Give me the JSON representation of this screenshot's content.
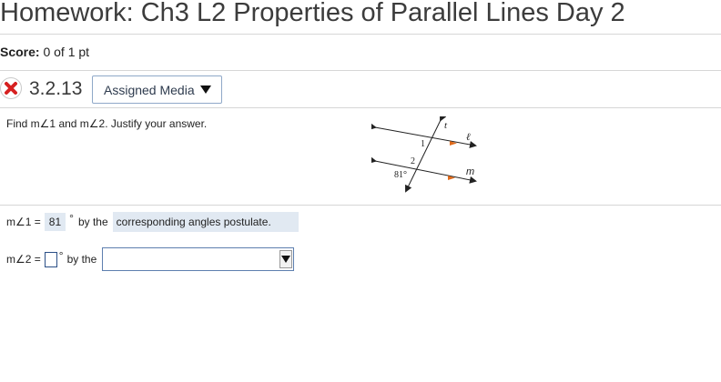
{
  "header": {
    "title": "Homework: Ch3 L2 Properties of Parallel Lines Day 2"
  },
  "score": {
    "label": "Score:",
    "value": "0 of 1 pt"
  },
  "question": {
    "number": "3.2.13",
    "media_button": "Assigned Media",
    "prompt": "Find m∠1 and m∠2. Justify your answer."
  },
  "figure": {
    "transversal_label": "t",
    "line_l_label": "ℓ",
    "line_m_label": "m",
    "angle1_label": "1",
    "angle2_label": "2",
    "given_angle_label": "81°",
    "arrow_color": "#e06a1a"
  },
  "answer1": {
    "label": "m∠1 =",
    "value": "81",
    "degree": "°",
    "by_the": "by the",
    "justification": "corresponding angles postulate."
  },
  "answer2": {
    "label": "m∠2 =",
    "value": "",
    "degree": "°",
    "by_the": "by the",
    "selected": ""
  },
  "colors": {
    "input_border": "#2b4f86",
    "answer_bg": "#e1e9f2",
    "wrong_mark": "#d62020"
  }
}
